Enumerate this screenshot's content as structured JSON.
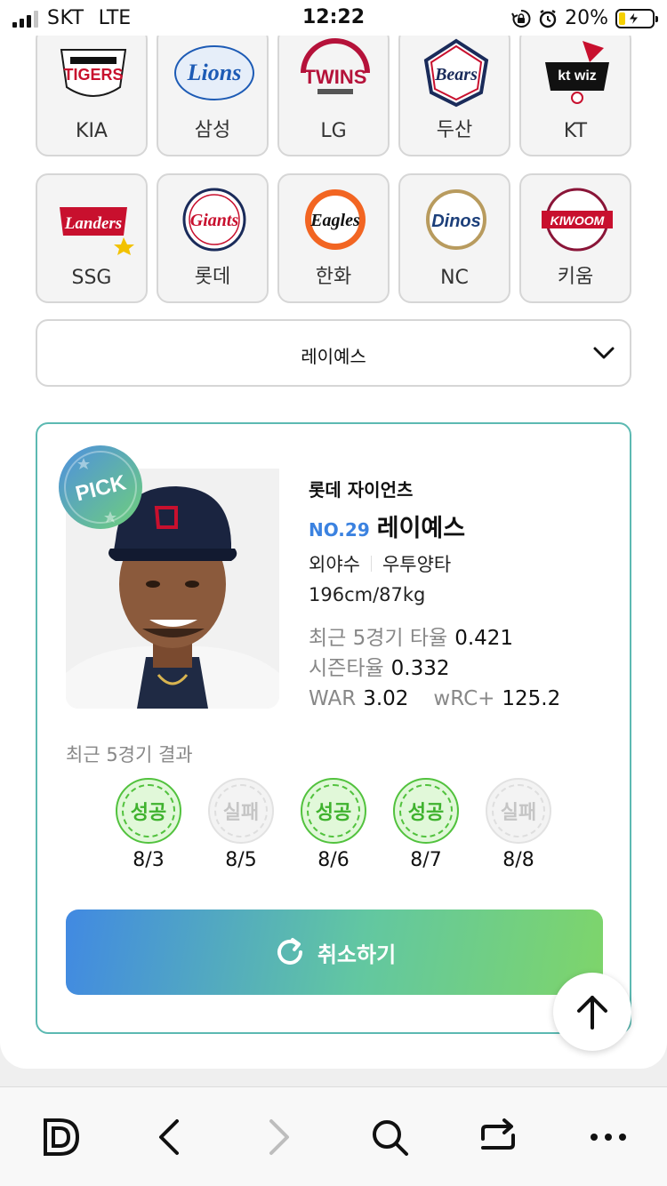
{
  "status_bar": {
    "carrier": "SKT",
    "network": "LTE",
    "time": "12:22",
    "battery_percent": "20%",
    "battery_level": 0.2,
    "icons": [
      "signal-icon",
      "orientation-lock-icon",
      "alarm-icon",
      "battery-charging-icon"
    ]
  },
  "teams": [
    {
      "name": "KIA",
      "logo_text": "TIGERS",
      "color": "#c8102e"
    },
    {
      "name": "삼성",
      "logo_text": "Lions",
      "color": "#1d5bb5"
    },
    {
      "name": "LG",
      "logo_text": "TWINS",
      "color": "#b5123a"
    },
    {
      "name": "두산",
      "logo_text": "Bears",
      "color": "#1a2b5a"
    },
    {
      "name": "KT",
      "logo_text": "kt wiz",
      "color": "#111111"
    },
    {
      "name": "SSG",
      "logo_text": "Landers",
      "color": "#c8102e"
    },
    {
      "name": "롯데",
      "logo_text": "Giants",
      "color": "#c8102e"
    },
    {
      "name": "한화",
      "logo_text": "Eagles",
      "color": "#f26522"
    },
    {
      "name": "NC",
      "logo_text": "Dinos",
      "color": "#1c3f7a"
    },
    {
      "name": "키움",
      "logo_text": "KIWOOM",
      "color": "#8a1538"
    }
  ],
  "player_select": {
    "value": "레이예스"
  },
  "player": {
    "pick_label": "PICK",
    "team": "롯데 자이언츠",
    "number": "NO.29",
    "name": "레이예스",
    "position": "외야수",
    "bats_throws": "우투양타",
    "body": "196cm/87kg",
    "stats": {
      "recent5_label": "최근 5경기 타율",
      "recent5_value": "0.421",
      "season_label": "시즌타율",
      "season_value": "0.332",
      "war_label": "WAR",
      "war_value": "3.02",
      "wrc_label": "wRC+",
      "wrc_value": "125.2"
    }
  },
  "recent_results": {
    "title": "최근 5경기 결과",
    "items": [
      {
        "result": "성공",
        "date": "8/3",
        "status": "win"
      },
      {
        "result": "실패",
        "date": "8/5",
        "status": "loss"
      },
      {
        "result": "성공",
        "date": "8/6",
        "status": "win"
      },
      {
        "result": "성공",
        "date": "8/7",
        "status": "win"
      },
      {
        "result": "실패",
        "date": "8/8",
        "status": "loss"
      }
    ]
  },
  "cancel_button": {
    "label": "취소하기"
  },
  "browser_toolbar": {
    "items": [
      "home-d-icon",
      "back-icon",
      "forward-icon",
      "search-icon",
      "share-icon",
      "more-icon"
    ]
  }
}
